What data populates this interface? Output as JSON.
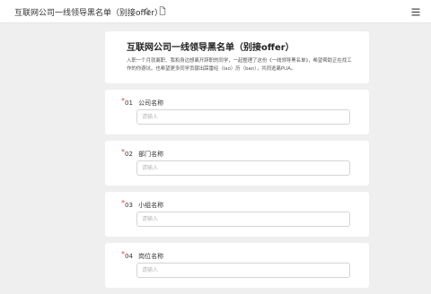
{
  "header": {
    "doc_title": "互联网公司一线领导黑名单（别接offer）",
    "star_icon": "star-icon",
    "doc_icon": "document-icon",
    "menu_icon": "hamburger-menu-icon"
  },
  "form": {
    "title": "互联网公司一线领导黑名单（别接offer）",
    "description": "入职一个月就离职、我和身边想离开辞职的同学，一起整理了这份《一线领导黑名单》，希望帮助正在找工作的你避坑。也希望更多同学贡献出踩雷经（lao）历（ban），共同逃离PUA。",
    "questions": [
      {
        "number": "01",
        "label": "公司名称",
        "placeholder": "请输入"
      },
      {
        "number": "02",
        "label": "部门名称",
        "placeholder": "请输入"
      },
      {
        "number": "03",
        "label": "小组名称",
        "placeholder": "请输入"
      },
      {
        "number": "04",
        "label": "岗位名称",
        "placeholder": "请输入"
      }
    ]
  },
  "colors": {
    "required": "#e5483a",
    "background": "#efefef"
  }
}
